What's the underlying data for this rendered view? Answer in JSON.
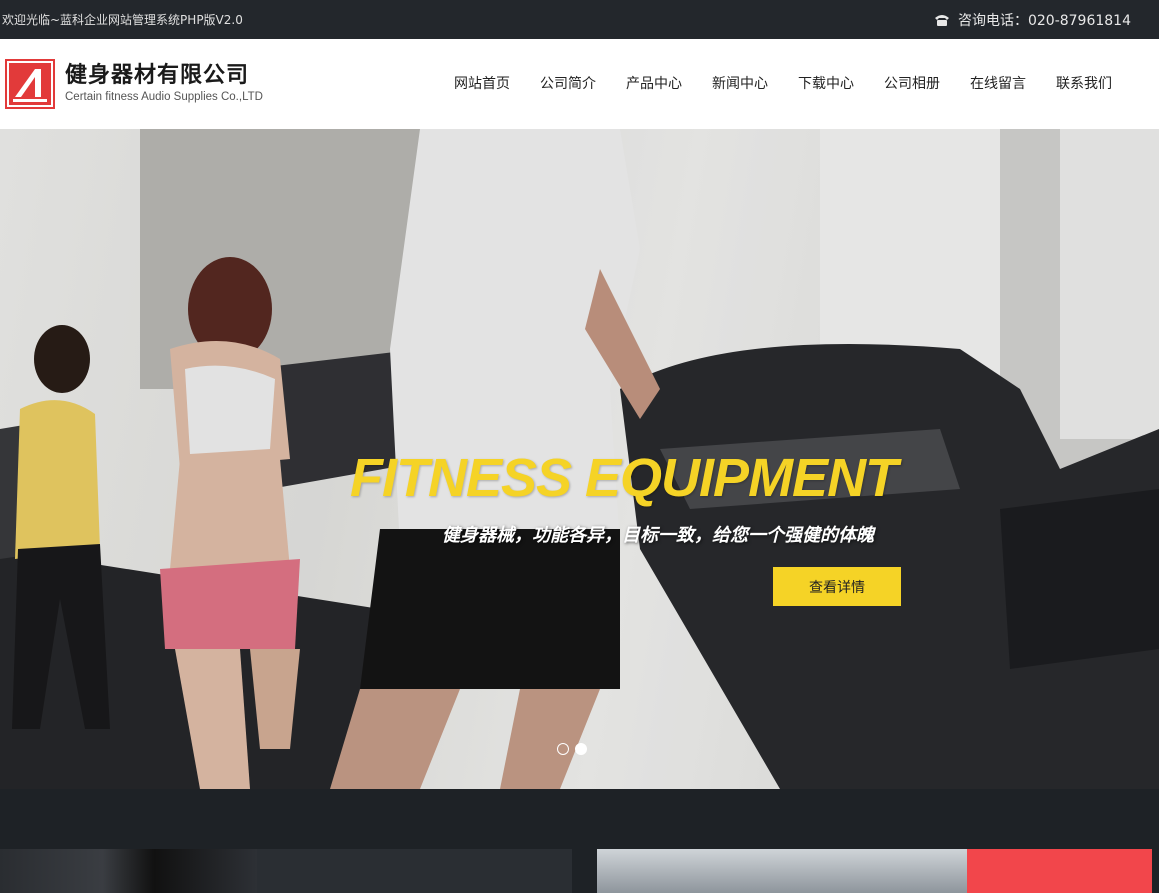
{
  "topbar": {
    "welcome": "欢迎光临~蓝科企业网站管理系统PHP版V2.0",
    "phone": "咨询电话：020-87961814"
  },
  "header": {
    "logo_cn": "健身器材有限公司",
    "logo_en": "Certain fitness Audio Supplies Co.,LTD",
    "nav": [
      "网站首页",
      "公司简介",
      "产品中心",
      "新闻中心",
      "下载中心",
      "公司相册",
      "在线留言",
      "联系我们"
    ]
  },
  "hero": {
    "title": "FITNESS EQUIPMENT",
    "subtitle": "健身器械，功能各异，目标一致，给您一个强健的体魄",
    "button": "查看详情",
    "slides": 2,
    "active_slide": 2
  },
  "colors": {
    "accent": "#f5d326",
    "topbar": "#23272c",
    "logo_red": "#e23a3a",
    "card_red": "#f2464b"
  }
}
